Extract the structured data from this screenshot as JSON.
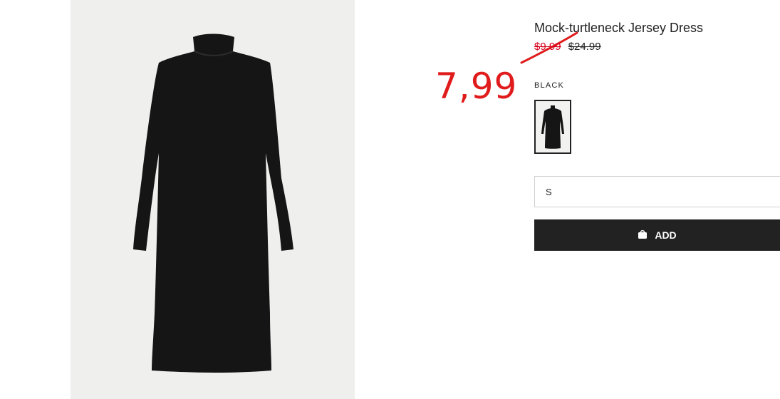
{
  "annotation": {
    "handwritten_price": "7,99"
  },
  "product": {
    "title": "Mock-turtleneck Jersey Dress",
    "sale_price": "$9.99",
    "original_price": "$24.99",
    "color_label": "BLACK",
    "selected_size": "S",
    "add_label": "ADD"
  },
  "colors": {
    "sale_red": "#d6001c",
    "annotation_red": "#e01b1b",
    "button": "#222222"
  },
  "icons": {
    "bag": "shopping-bag-icon"
  }
}
